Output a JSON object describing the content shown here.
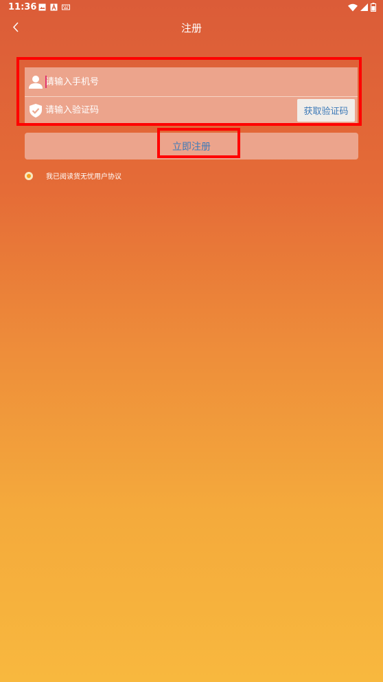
{
  "status_bar": {
    "time": "11:36",
    "left_icons": [
      "image-icon",
      "a-icon",
      "keyboard-icon"
    ],
    "right_icons": [
      "wifi-icon",
      "signal-icon",
      "battery-icon"
    ]
  },
  "nav": {
    "title": "注册",
    "back_icon": "chevron-left-icon"
  },
  "form": {
    "phone_placeholder": "请输入手机号",
    "phone_icon": "user-icon",
    "code_placeholder": "请输入验证码",
    "code_icon": "shield-check-icon",
    "get_code_label": "获取验证码"
  },
  "submit_label": "立即注册",
  "agreement": {
    "checked": true,
    "text": "我已阅读货无忧用户协议"
  },
  "colors": {
    "gradient_top": "#db5c38",
    "gradient_bottom": "#f8b83e",
    "link_blue": "#3d7ab8",
    "highlight_red": "#ff0000"
  }
}
